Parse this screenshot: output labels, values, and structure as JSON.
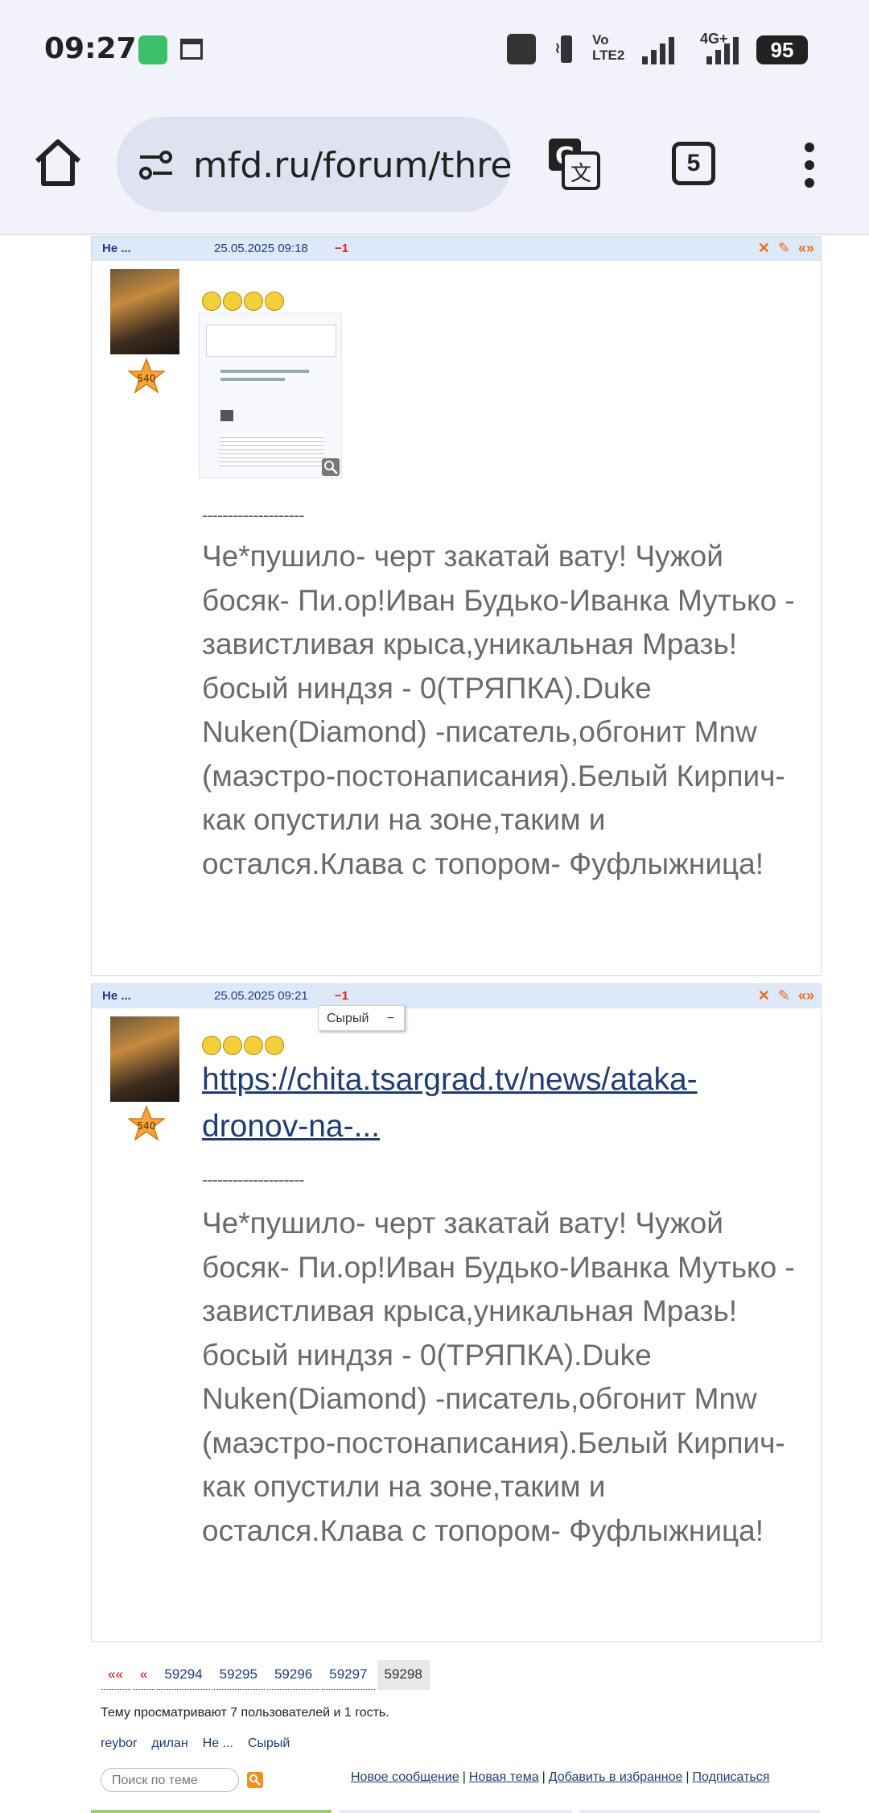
{
  "status_bar": {
    "time": "09:27",
    "network": "4G+",
    "volte": "Vo LTE2",
    "battery": "95"
  },
  "browser": {
    "url": "mfd.ru/forum/thre",
    "tab_count": "5"
  },
  "posts": [
    {
      "author": "Не ...",
      "date": "25.05.2025 09:18",
      "rating": "−1",
      "rank": "540",
      "signature_line": "--------------------",
      "signature": "Че*пушило- черт закатай вату! Чужой босяк- Пи.ор!Иван Будько-Иванка Мутько - завистливая крыса,уникальная Мразь!босый ниндзя - 0(ТРЯПКА).Duke Nuken(Diamond) -писатель,обгонит Mnw (маэстро-постонаписания).Белый Кирпич- как опустили на зоне,таким и остался.Клава с топором- Фуфлыжница!"
    },
    {
      "author": "Не ...",
      "date": "25.05.2025 09:21",
      "rating": "−1",
      "rank": "540",
      "link": "https://chita.tsargrad.tv/news/ataka-dronov-na-...",
      "signature_line": "--------------------",
      "signature": "Че*пушило- черт закатай вату! Чужой босяк- Пи.ор!Иван Будько-Иванка Мутько - завистливая крыса,уникальная Мразь!босый ниндзя - 0(ТРЯПКА).Duke Nuken(Diamond) -писатель,обгонит Mnw (маэстро-постонаписания).Белый Кирпич- как опустили на зоне,таким и остался.Клава с топором- Фуфлыжница!"
    }
  ],
  "tooltip": {
    "name": "Сырый",
    "value": "−"
  },
  "pager": {
    "first": "««",
    "prev": "«",
    "pages": [
      "59294",
      "59295",
      "59296",
      "59297"
    ],
    "current": "59298"
  },
  "viewers_text": "Тему просматривают 7 пользователей и 1 гость.",
  "users": [
    "reybor",
    "дилан",
    "Не ...",
    "Сырый"
  ],
  "search_placeholder": "Поиск по теме",
  "bottom_links": [
    "Новое сообщение",
    "Новая тема",
    "Добавить в избранное",
    "Подписаться"
  ]
}
